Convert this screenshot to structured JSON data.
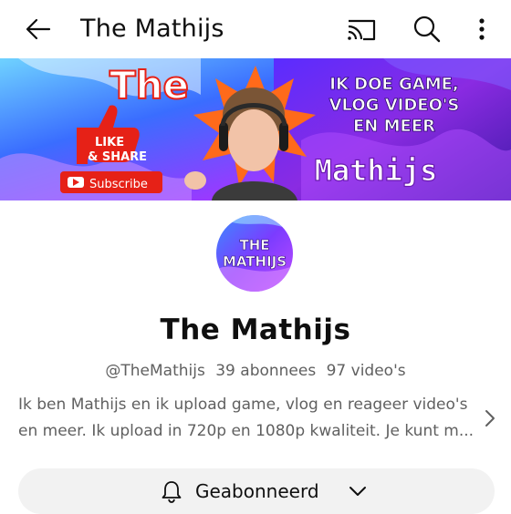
{
  "header": {
    "title": "The Mathijs"
  },
  "banner": {
    "brand_word": "The",
    "name_word": "Mathijs",
    "tagline": [
      "IK DOE GAME,",
      "VLOG VIDEO'S",
      "EN MEER"
    ],
    "like_label": "LIKE",
    "share_label": "& SHARE",
    "subscribe_label": "Subscribe"
  },
  "avatar": {
    "line1": "THE",
    "line2": "MATHIJS"
  },
  "channel": {
    "name": "The Mathijs",
    "handle": "@TheMathijs",
    "subscribers": "39 abonnees",
    "videos": "97 video's",
    "description_line1": "Ik ben Mathijs en ik upload game, vlog en reageer video's",
    "description_line2": "en meer. Ik upload in 720p en 1080p kwaliteit. Je kunt m..."
  },
  "subscribe_button": {
    "label": "Geabonneerd"
  },
  "colors": {
    "text_primary": "#0f0f0f",
    "text_secondary": "#606060",
    "button_bg": "#f2f2f2",
    "youtube_red": "#e62117"
  },
  "icons": {
    "back": "arrow-left-icon",
    "cast": "cast-icon",
    "search": "search-icon",
    "more": "more-vert-icon",
    "bell": "bell-icon",
    "chevron_down": "chevron-down-icon",
    "chevron_right": "chevron-right-icon"
  }
}
